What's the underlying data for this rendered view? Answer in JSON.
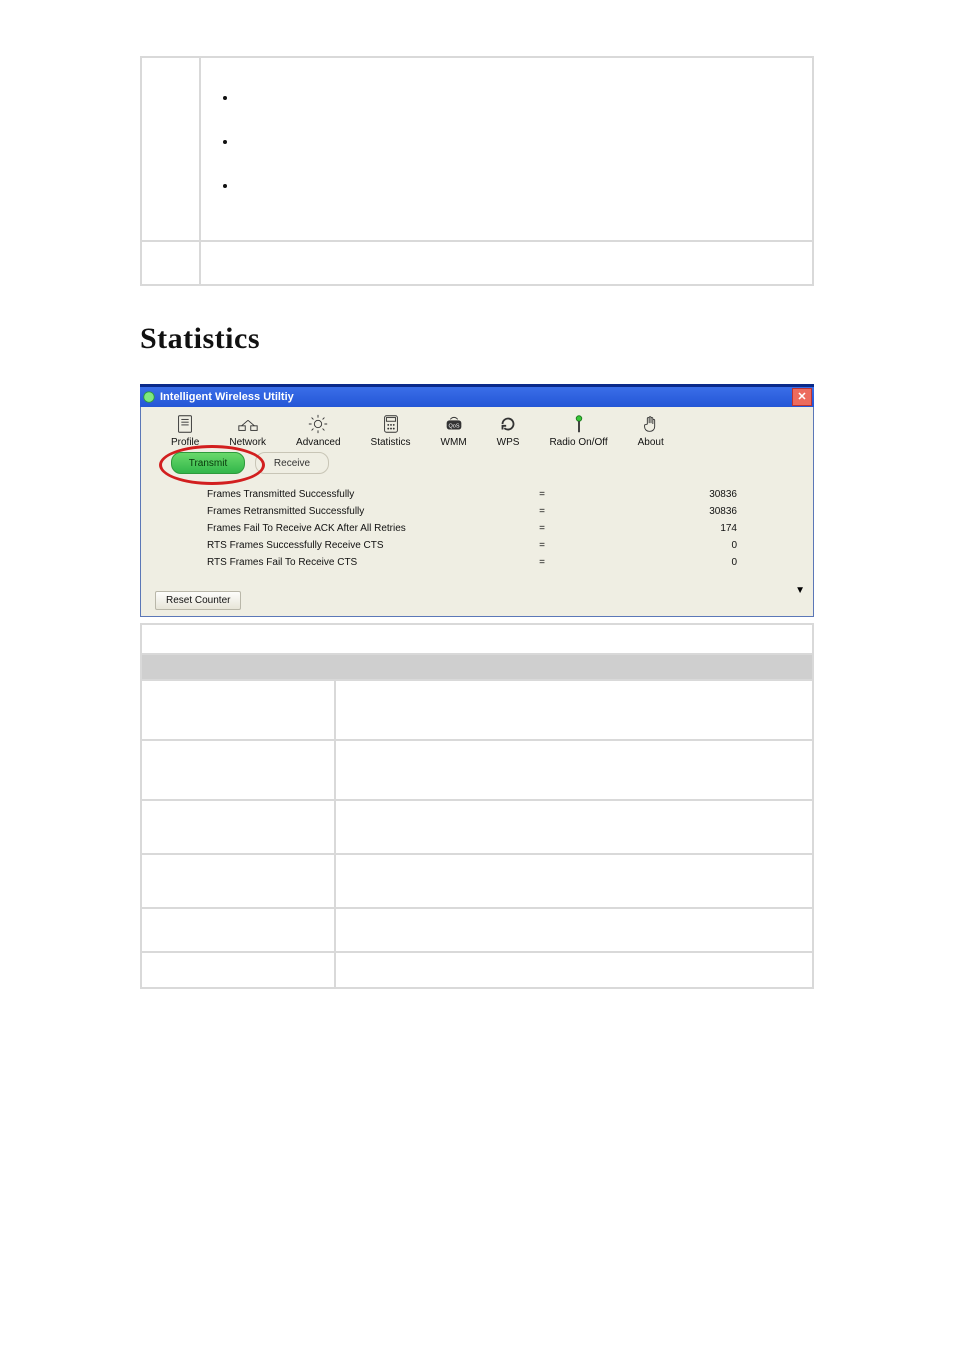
{
  "heading": "Statistics",
  "window": {
    "title": "Intelligent Wireless Utiltiy",
    "toolbar": [
      {
        "name": "profile",
        "label": "Profile"
      },
      {
        "name": "network",
        "label": "Network"
      },
      {
        "name": "advanced",
        "label": "Advanced"
      },
      {
        "name": "statistics",
        "label": "Statistics"
      },
      {
        "name": "wmm",
        "label": "WMM"
      },
      {
        "name": "wps",
        "label": "WPS"
      },
      {
        "name": "radio",
        "label": "Radio On/Off"
      },
      {
        "name": "about",
        "label": "About"
      }
    ],
    "tabs": {
      "transmit": "Transmit",
      "receive": "Receive"
    },
    "rows": [
      {
        "label": "Frames Transmitted Successfully",
        "eq": "=",
        "value": "30836"
      },
      {
        "label": "Frames Retransmitted Successfully",
        "eq": "=",
        "value": "30836"
      },
      {
        "label": "Frames Fail To Receive ACK After All Retries",
        "eq": "=",
        "value": "174"
      },
      {
        "label": "RTS Frames Successfully Receive CTS",
        "eq": "=",
        "value": "0"
      },
      {
        "label": "RTS Frames Fail To Receive CTS",
        "eq": "=",
        "value": "0"
      }
    ],
    "reset_label": "Reset Counter"
  },
  "bullets": [
    "",
    "",
    ""
  ]
}
